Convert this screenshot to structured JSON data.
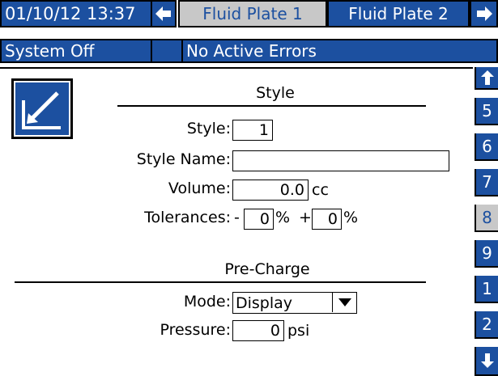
{
  "header": {
    "datetime": "01/10/12 13:37",
    "tabs": [
      {
        "label": "Fluid Plate 1",
        "active": true
      },
      {
        "label": "Fluid Plate 2",
        "active": false
      }
    ],
    "left_arrow_icon": "arrow-left-icon",
    "right_arrow_icon": "arrow-right-icon"
  },
  "status": {
    "system": "System Off",
    "errors": "No Active Errors"
  },
  "main": {
    "edit_icon": "edit-icon",
    "style_section": {
      "title": "Style",
      "style_label": "Style:",
      "style_value": "1",
      "style_name_label": "Style Name:",
      "style_name_value": "",
      "volume_label": "Volume:",
      "volume_value": "0.0",
      "volume_unit": "cc",
      "tolerances_label": "Tolerances:",
      "minus_sign": "-",
      "tol_minus_value": "0",
      "percent1": "%",
      "plus_sign": "+",
      "tol_plus_value": "0",
      "percent2": "%"
    },
    "precharge_section": {
      "title": "Pre-Charge",
      "mode_label": "Mode:",
      "mode_value": "Display",
      "pressure_label": "Pressure:",
      "pressure_value": "0",
      "pressure_unit": "psi"
    }
  },
  "sidebar": {
    "up_icon": "arrow-up-icon",
    "down_icon": "arrow-down-icon",
    "items": [
      {
        "label": "5",
        "active": false
      },
      {
        "label": "6",
        "active": false
      },
      {
        "label": "7",
        "active": false
      },
      {
        "label": "8",
        "active": true
      },
      {
        "label": "9",
        "active": false
      },
      {
        "label": "1",
        "active": false
      },
      {
        "label": "2",
        "active": false
      }
    ]
  },
  "colors": {
    "accent_blue": "#1c50a0",
    "inactive_gray": "#c8c8c8",
    "background": "#ffffff"
  }
}
